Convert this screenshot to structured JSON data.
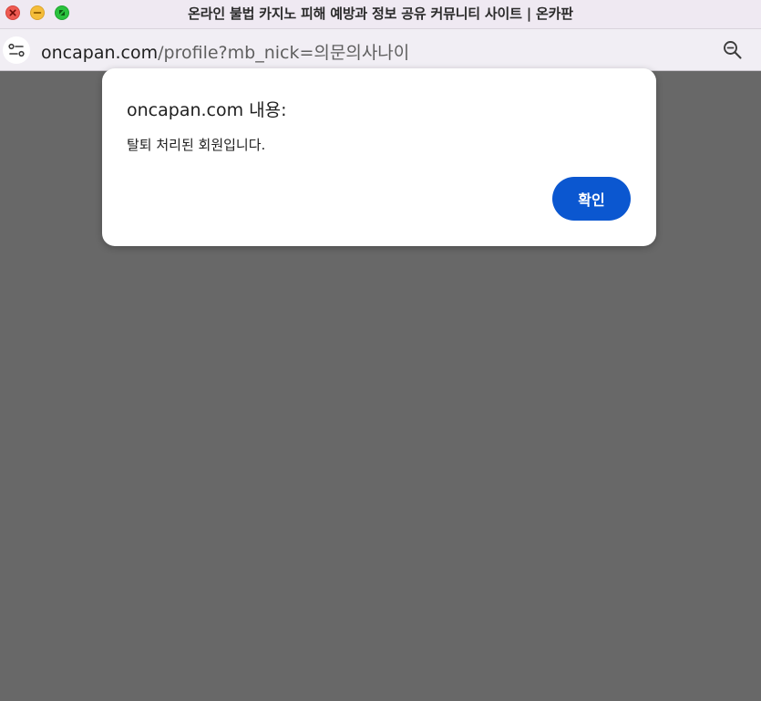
{
  "window": {
    "title": "온라인 불법 카지노 피해 예방과 정보 공유 커뮤니티 사이트 | 온카판"
  },
  "address_bar": {
    "domain": "oncapan.com",
    "path": "/profile?mb_nick=의문의사나이"
  },
  "dialog": {
    "title": "oncapan.com 내용:",
    "message": "탈퇴 처리된 회원입니다.",
    "ok_label": "확인"
  },
  "colors": {
    "overlay": "#686868",
    "button": "#0b57d0",
    "close": "#ee5a52",
    "minimize": "#f5bd3a",
    "maximize": "#2bc23e"
  }
}
